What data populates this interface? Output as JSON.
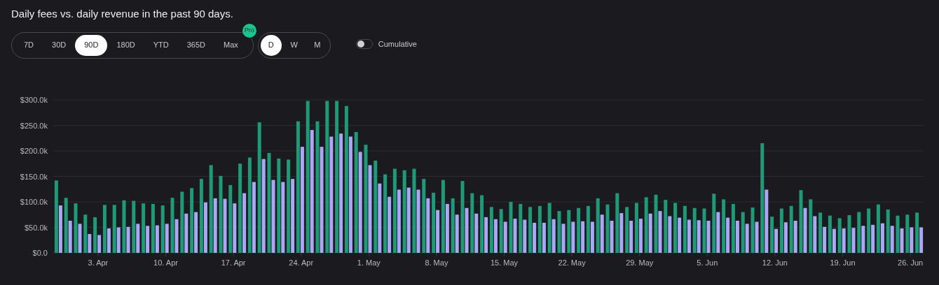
{
  "title": "Daily fees vs. daily revenue in the past 90 days.",
  "ranges": [
    {
      "label": "7D",
      "selected": false
    },
    {
      "label": "30D",
      "selected": false
    },
    {
      "label": "90D",
      "selected": true
    },
    {
      "label": "180D",
      "selected": false
    },
    {
      "label": "YTD",
      "selected": false
    },
    {
      "label": "365D",
      "selected": false
    },
    {
      "label": "Max",
      "selected": false,
      "badge": "Pro"
    }
  ],
  "granularity": [
    {
      "label": "D",
      "selected": true
    },
    {
      "label": "W",
      "selected": false
    },
    {
      "label": "M",
      "selected": false
    }
  ],
  "cumulative": {
    "label": "Cumulative",
    "on": false
  },
  "chart_data": {
    "type": "bar",
    "ylim": [
      0,
      300
    ],
    "yticks": [
      {
        "value": 0,
        "label": "$0.0"
      },
      {
        "value": 50,
        "label": "$50.0k"
      },
      {
        "value": 100,
        "label": "$100.0k"
      },
      {
        "value": 150,
        "label": "$150.0k"
      },
      {
        "value": 200,
        "label": "$200.0k"
      },
      {
        "value": 250,
        "label": "$250.0k"
      },
      {
        "value": 300,
        "label": "$300.0k"
      }
    ],
    "grid": true,
    "series": [
      {
        "color": "#1f9a76",
        "values": [
          142,
          108,
          97,
          75,
          70,
          94,
          94,
          103,
          102,
          97,
          96,
          93,
          108,
          120,
          127,
          145,
          172,
          151,
          133,
          175,
          187,
          256,
          196,
          185,
          183,
          258,
          298,
          258,
          298,
          298,
          288,
          237,
          212,
          181,
          154,
          165,
          162,
          165,
          145,
          118,
          143,
          107,
          141,
          117,
          113,
          90,
          86,
          100,
          96,
          90,
          92,
          98,
          82,
          84,
          88,
          92,
          107,
          95,
          117,
          90,
          98,
          109,
          114,
          104,
          98,
          92,
          88,
          87,
          116,
          105,
          96,
          80,
          89,
          215,
          71,
          87,
          92,
          123,
          105,
          79,
          73,
          68,
          74,
          80,
          87,
          95,
          85,
          73,
          75,
          79
        ]
      },
      {
        "color": "#aaa8f5",
        "values": [
          93,
          63,
          57,
          37,
          35,
          48,
          50,
          51,
          57,
          53,
          54,
          57,
          66,
          77,
          80,
          99,
          107,
          106,
          97,
          117,
          139,
          184,
          143,
          139,
          145,
          208,
          241,
          208,
          228,
          234,
          228,
          198,
          172,
          136,
          110,
          124,
          128,
          124,
          107,
          84,
          96,
          75,
          88,
          77,
          70,
          66,
          61,
          67,
          65,
          59,
          59,
          66,
          57,
          61,
          62,
          61,
          75,
          63,
          78,
          63,
          67,
          77,
          82,
          72,
          69,
          65,
          64,
          63,
          80,
          69,
          63,
          57,
          61,
          124,
          47,
          60,
          63,
          88,
          72,
          51,
          47,
          48,
          49,
          53,
          55,
          58,
          53,
          48,
          50,
          50
        ]
      }
    ]
  },
  "x_axis_labels": [
    "3. Apr",
    "10. Apr",
    "17. Apr",
    "24. Apr",
    "1. May",
    "8. May",
    "15. May",
    "22. May",
    "29. May",
    "5. Jun",
    "12. Jun",
    "19. Jun",
    "26. Jun"
  ]
}
